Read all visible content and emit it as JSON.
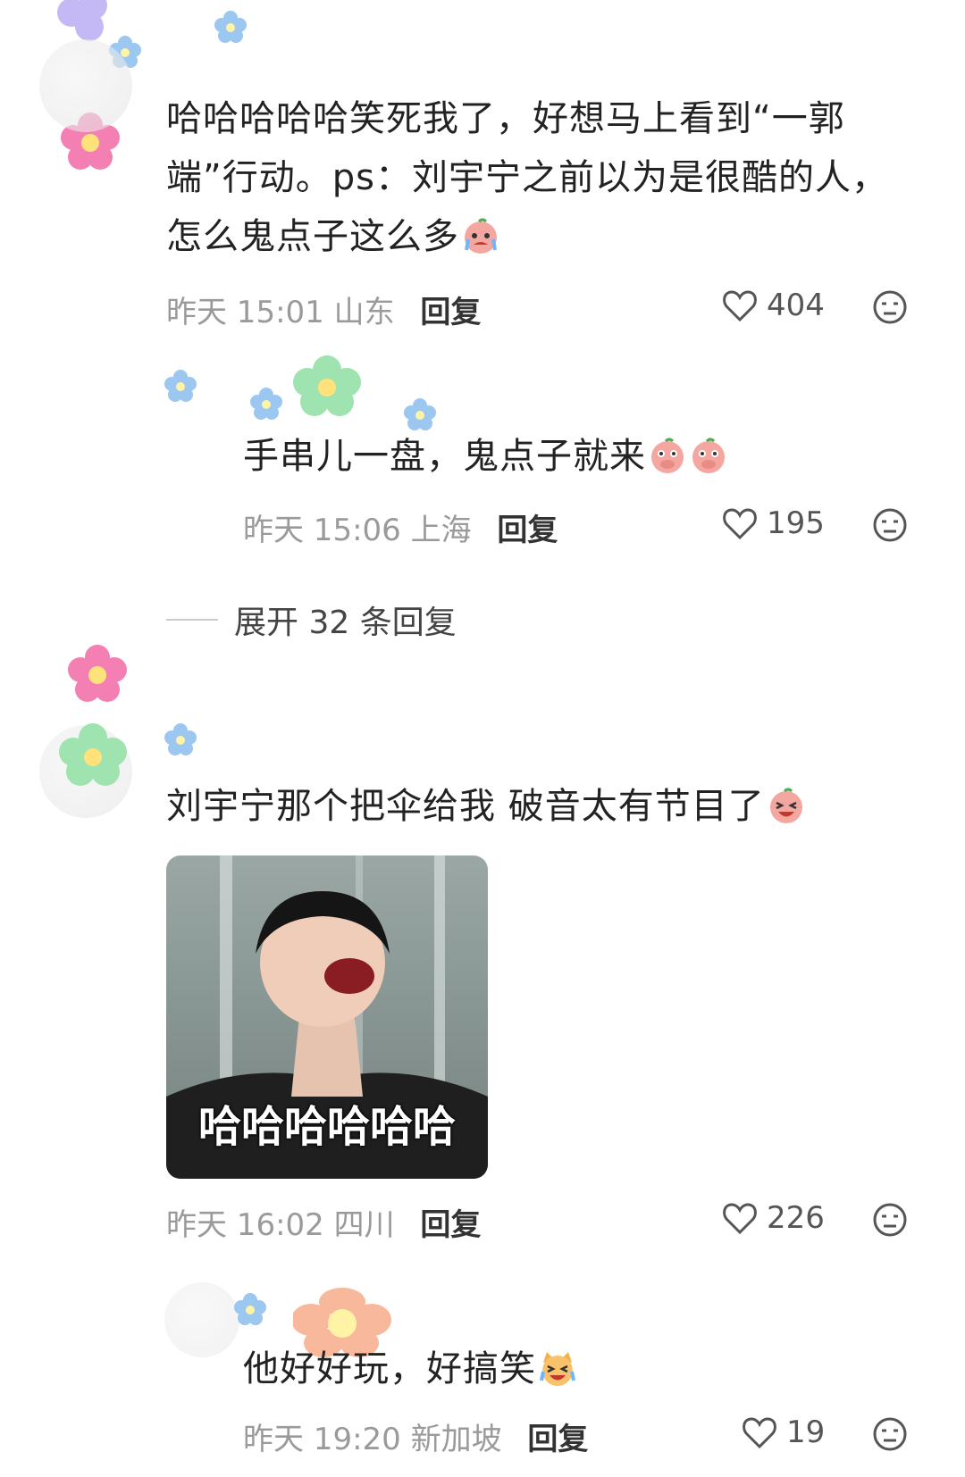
{
  "comments": [
    {
      "text": "哈哈哈哈哈笑死我了，好想马上看到“一郭端”行动。ps：刘宇宁之前以为是很酷的人，怎么鬼点子这么多",
      "time": "昨天 15:01",
      "location": "山东",
      "reply_label": "回复",
      "likes": "404"
    },
    {
      "text": "手串儿一盘，鬼点子就来",
      "time": "昨天 15:06",
      "location": "上海",
      "reply_label": "回复",
      "likes": "195"
    },
    {
      "text": "刘宇宁那个把伞给我 破音太有节目了",
      "time": "昨天 16:02",
      "location": "四川",
      "reply_label": "回复",
      "likes": "226",
      "image_caption": "哈哈哈哈哈哈"
    },
    {
      "text": "他好好玩，好搞笑",
      "time": "昨天 19:20",
      "location": "新加坡",
      "reply_label": "回复",
      "likes": "19"
    }
  ],
  "expand_replies": "展开 32 条回复",
  "icons": {
    "like": "heart-outline-icon",
    "dislike": "neutral-face-icon",
    "emoji_cry": "crying-peach-emoji",
    "emoji_cover_mouth": "peach-cover-mouth-emoji",
    "emoji_laugh": "laughing-peach-emoji",
    "emoji_cat": "laughing-cat-emoji"
  },
  "colors": {
    "text": "#222222",
    "meta": "#9a9a9a",
    "flower_pink": "#f47fb2",
    "flower_green": "#9fe3b1",
    "flower_blue": "#9cc7f0",
    "flower_orange": "#f8b89b"
  }
}
